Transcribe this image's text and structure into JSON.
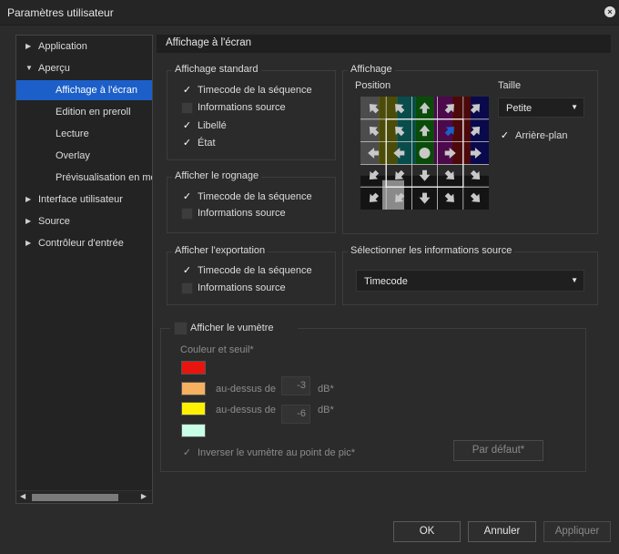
{
  "window": {
    "title": "Paramètres utilisateur"
  },
  "tree": {
    "items": [
      {
        "label": "Application",
        "expander": "▶",
        "level": 0,
        "selected": false
      },
      {
        "label": "Aperçu",
        "expander": "▼",
        "level": 0,
        "selected": false
      },
      {
        "label": "Affichage à l'écran",
        "expander": "",
        "level": 1,
        "selected": true
      },
      {
        "label": "Edition en preroll",
        "expander": "",
        "level": 1,
        "selected": false
      },
      {
        "label": "Lecture",
        "expander": "",
        "level": 1,
        "selected": false
      },
      {
        "label": "Overlay",
        "expander": "",
        "level": 1,
        "selected": false
      },
      {
        "label": "Prévisualisation en mo",
        "expander": "",
        "level": 1,
        "selected": false
      },
      {
        "label": "Interface utilisateur",
        "expander": "▶",
        "level": 0,
        "selected": false
      },
      {
        "label": "Source",
        "expander": "▶",
        "level": 0,
        "selected": false
      },
      {
        "label": "Contrôleur d'entrée",
        "expander": "▶",
        "level": 0,
        "selected": false
      }
    ],
    "scroll_left": "◀",
    "scroll_right": "▶"
  },
  "panel": {
    "title": "Affichage à l'écran"
  },
  "affichage_standard": {
    "label": "Affichage standard",
    "options": [
      {
        "label": "Timecode de la séquence",
        "checked": true
      },
      {
        "label": "Informations source",
        "checked": false
      },
      {
        "label": "Libellé",
        "checked": true
      },
      {
        "label": "État",
        "checked": true
      }
    ]
  },
  "afficher_rognage": {
    "label": "Afficher le rognage",
    "options": [
      {
        "label": "Timecode de la séquence",
        "checked": true
      },
      {
        "label": "Informations source",
        "checked": false
      }
    ]
  },
  "afficher_exportation": {
    "label": "Afficher l'exportation",
    "options": [
      {
        "label": "Timecode de la séquence",
        "checked": true
      },
      {
        "label": "Informations source",
        "checked": false
      }
    ]
  },
  "affichage": {
    "label": "Affichage",
    "position_label": "Position",
    "taille_label": "Taille",
    "taille_value": "Petite",
    "arriere_plan_label": "Arrière-plan",
    "arriere_plan_checked": true,
    "selected_cell": "top-right",
    "bar_colors": [
      "#7a7a7a",
      "#7a7a00",
      "#007a7a",
      "#007a00",
      "#7a007a",
      "#7a0000",
      "#00007a"
    ]
  },
  "source_info": {
    "label": "Sélectionner les informations source",
    "value": "Timecode"
  },
  "vumetre": {
    "label": "Afficher le vumètre",
    "checked": false,
    "color_label": "Couleur et seuil*",
    "colors": [
      "#e8140e",
      "#f5b060",
      "#fff200",
      "#c8ffe6"
    ],
    "above_label": "au-dessus de",
    "threshold1": "-3",
    "threshold2": "-6",
    "unit": "dB*",
    "invert_label": "Inverser le vumètre au point de pic*",
    "invert_checked": true,
    "default_button": "Par défaut*"
  },
  "buttons": {
    "ok": "OK",
    "cancel": "Annuler",
    "apply": "Appliquer"
  },
  "check_glyph": "✓",
  "close_glyph": "×",
  "combo_caret": "▼"
}
